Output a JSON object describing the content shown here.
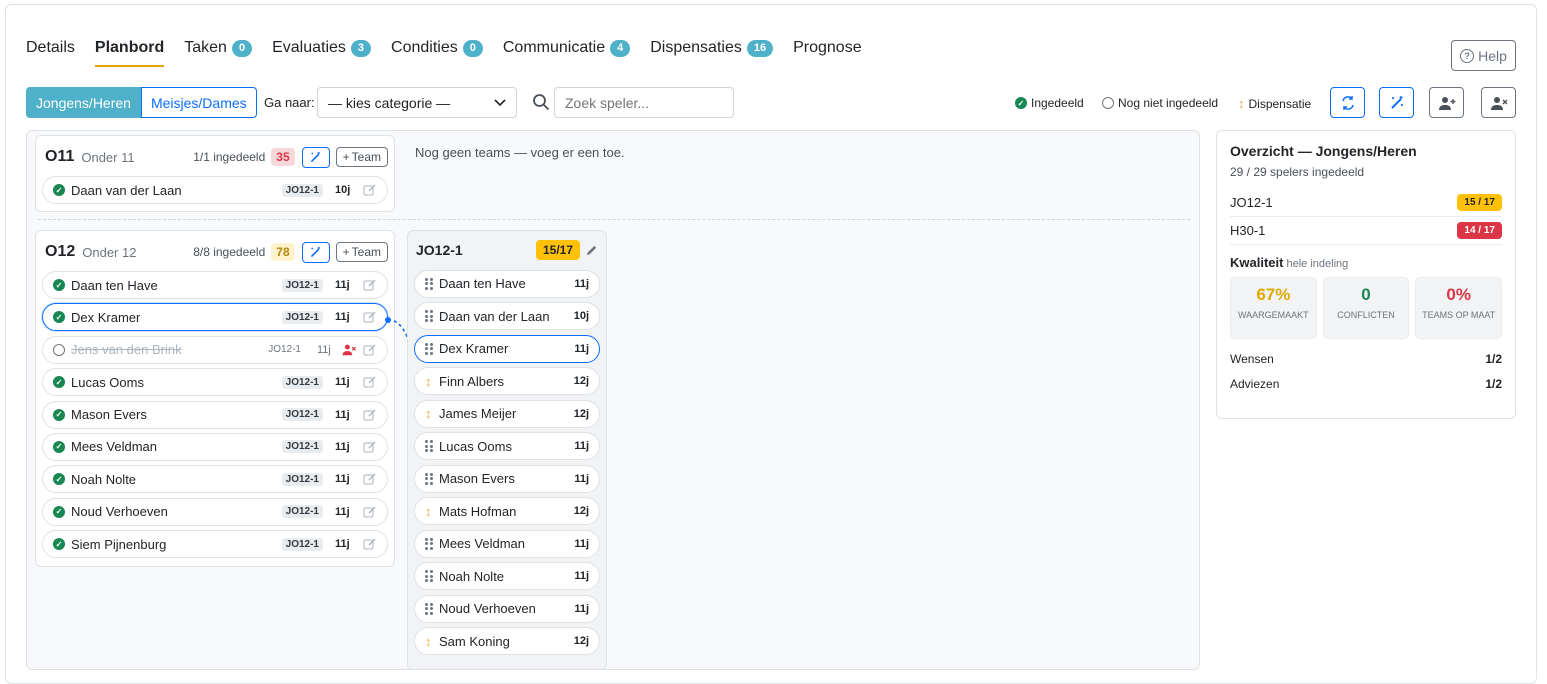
{
  "tabs": [
    {
      "label": "Details",
      "badge": ""
    },
    {
      "label": "Planbord",
      "badge": ""
    },
    {
      "label": "Taken",
      "badge": "0"
    },
    {
      "label": "Evaluaties",
      "badge": "3"
    },
    {
      "label": "Condities",
      "badge": "0"
    },
    {
      "label": "Communicatie",
      "badge": "4"
    },
    {
      "label": "Dispensaties",
      "badge": "16"
    },
    {
      "label": "Prognose",
      "badge": ""
    }
  ],
  "help_label": "Help",
  "toolbar": {
    "seg_on": "Jongens/Heren",
    "seg_off": "Meisjes/Dames",
    "ga_naar": "Ga naar:",
    "select_value": "— kies categorie —",
    "search_placeholder": "Zoek speler...",
    "legend_in": "Ingedeeld",
    "legend_not": "Nog niet ingedeeld",
    "legend_disp": "Dispensatie"
  },
  "no_teams": "Nog geen teams — voeg er een toe.",
  "o11": {
    "name": "O11",
    "sub": "Onder 11",
    "count": "1/1 ingedeeld",
    "score": "35",
    "team_btn": "Team",
    "players": [
      {
        "name": "Daan van der Laan",
        "tag": "JO12-1",
        "age": "10j"
      }
    ]
  },
  "o12": {
    "name": "O12",
    "sub": "Onder 12",
    "count": "8/8 ingedeeld",
    "score": "78",
    "team_btn": "Team",
    "players": [
      {
        "name": "Daan ten Have",
        "tag": "JO12-1",
        "age": "11j"
      },
      {
        "name": "Dex Kramer",
        "tag": "JO12-1",
        "age": "11j"
      },
      {
        "name": "Jens van den Brink",
        "tag": "JO12-1",
        "age": "11j"
      },
      {
        "name": "Lucas Ooms",
        "tag": "JO12-1",
        "age": "11j"
      },
      {
        "name": "Mason Evers",
        "tag": "JO12-1",
        "age": "11j"
      },
      {
        "name": "Mees Veldman",
        "tag": "JO12-1",
        "age": "11j"
      },
      {
        "name": "Noah Nolte",
        "tag": "JO12-1",
        "age": "11j"
      },
      {
        "name": "Noud Verhoeven",
        "tag": "JO12-1",
        "age": "11j"
      },
      {
        "name": "Siem Pijnenburg",
        "tag": "JO12-1",
        "age": "11j"
      }
    ]
  },
  "team": {
    "name": "JO12-1",
    "count": "15/17",
    "players": [
      {
        "name": "Daan ten Have",
        "age": "11j"
      },
      {
        "name": "Daan van der Laan",
        "age": "10j"
      },
      {
        "name": "Dex Kramer",
        "age": "11j"
      },
      {
        "name": "Finn Albers",
        "age": "12j"
      },
      {
        "name": "James Meijer",
        "age": "12j"
      },
      {
        "name": "Lucas Ooms",
        "age": "11j"
      },
      {
        "name": "Mason Evers",
        "age": "11j"
      },
      {
        "name": "Mats Hofman",
        "age": "12j"
      },
      {
        "name": "Mees Veldman",
        "age": "11j"
      },
      {
        "name": "Noah Nolte",
        "age": "11j"
      },
      {
        "name": "Noud Verhoeven",
        "age": "11j"
      },
      {
        "name": "Sam Koning",
        "age": "12j"
      }
    ]
  },
  "overview": {
    "title": "Overzicht — Jongens/Heren",
    "sub": "29 / 29 spelers ingedeeld",
    "teams": [
      {
        "name": "JO12-1",
        "count": "15 / 17"
      },
      {
        "name": "H30-1",
        "count": "14 / 17"
      }
    ],
    "kw_title": "Kwaliteit",
    "kw_sub": "hele indeling",
    "kpis": [
      {
        "value": "67%",
        "label": "WAARGEMAAKT"
      },
      {
        "value": "0",
        "label": "CONFLICTEN"
      },
      {
        "value": "0%",
        "label": "TEAMS OP MAAT"
      }
    ],
    "wensen_label": "Wensen",
    "wensen_value": "1/2",
    "adviezen_label": "Adviezen",
    "adviezen_value": "1/2"
  },
  "colors": {
    "accent": "#4eb1c9",
    "primary": "#0d6efd",
    "success": "#198754",
    "warning": "#ffc107",
    "danger": "#dc3545"
  }
}
